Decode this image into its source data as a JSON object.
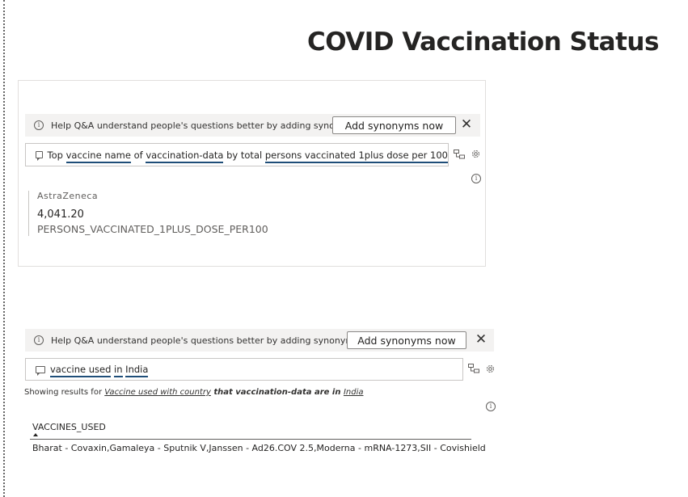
{
  "page": {
    "title": "COVID Vaccination Status"
  },
  "visual1": {
    "banner": {
      "message": "Help Q&A understand people's questions better by adding synonyms.",
      "button_label": "Add synonyms now",
      "close_glyph": "✕"
    },
    "question": {
      "segments": [
        {
          "text": "Top ",
          "underline": false
        },
        {
          "text": "vaccine name",
          "underline": true
        },
        {
          "text": " of ",
          "underline": false
        },
        {
          "text": "vaccination-data",
          "underline": true
        },
        {
          "text": " by total ",
          "underline": false
        },
        {
          "text": "persons vaccinated 1plus dose per 100",
          "underline": true
        }
      ]
    },
    "card": {
      "category": "AstraZeneca",
      "value": "4,041.20",
      "label": "PERSONS_VACCINATED_1PLUS_DOSE_PER100"
    }
  },
  "visual2": {
    "banner": {
      "message": "Help Q&A understand people's questions better by adding synonyms.",
      "button_label": "Add synonyms now",
      "close_glyph": "✕"
    },
    "question": {
      "segments": [
        {
          "text": "vaccine used",
          "underline": true
        },
        {
          "text": " ",
          "underline": false
        },
        {
          "text": "in",
          "underline": true
        },
        {
          "text": " ",
          "underline": false
        },
        {
          "text": "India",
          "underline": true
        }
      ]
    },
    "showing": {
      "prefix": "Showing results for ",
      "parts": [
        {
          "text": "Vaccine used",
          "style": "link"
        },
        {
          "text": " with ",
          "style": "link"
        },
        {
          "text": "country",
          "style": "link"
        },
        {
          "text": " that vaccination-data are in ",
          "style": "bold"
        },
        {
          "text": "India",
          "style": "link"
        }
      ]
    },
    "table": {
      "column_header": "VACCINES_USED",
      "rows": [
        "Bharat - Covaxin,Gamaleya - Sputnik V,Janssen - Ad26.COV 2.5,Moderna - mRNA-1273,SII - Covishield"
      ]
    }
  },
  "icons": {
    "info": "info-icon",
    "chat": "chat-icon",
    "share": "share-icon",
    "gear": "gear-icon",
    "close": "close-icon"
  },
  "colors": {
    "banner_bg": "#f3f2f1",
    "underline": "#1f4e79",
    "text": "#252423",
    "muted": "#605e5c"
  }
}
